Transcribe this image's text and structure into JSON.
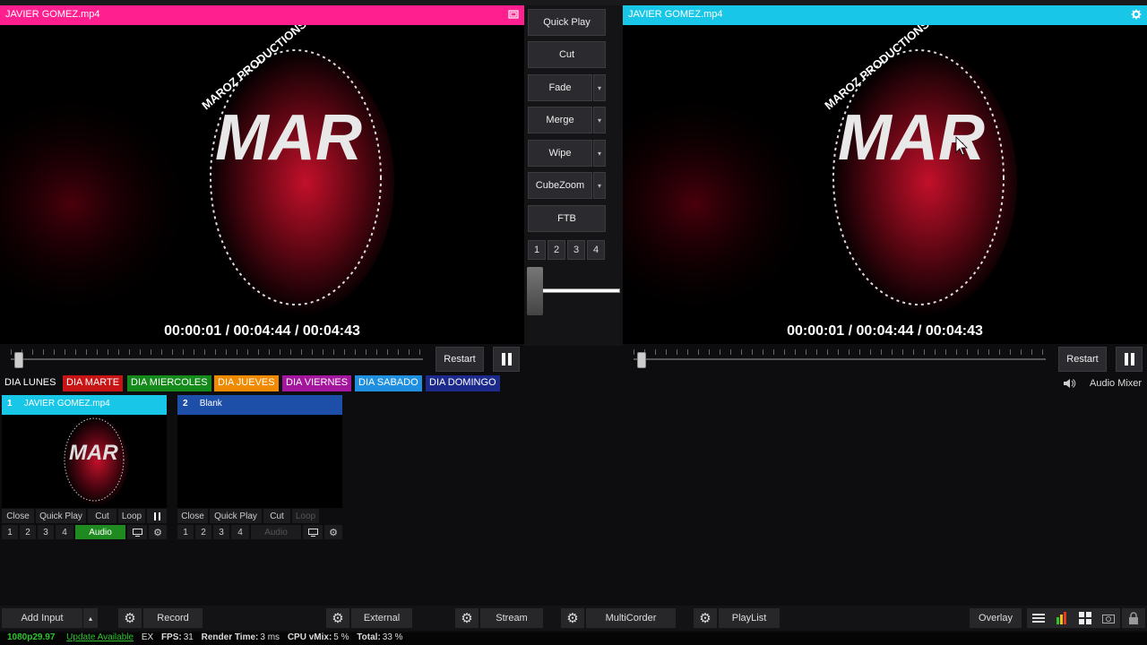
{
  "preview": {
    "title": "JAVIER GOMEZ.mp4",
    "timecode": "00:00:01  /  00:04:44  /  00:04:43",
    "restart_label": "Restart",
    "seek_fraction": 0.02
  },
  "output": {
    "title": "JAVIER GOMEZ.mp4",
    "timecode": "00:00:01  /  00:04:44  /  00:04:43",
    "restart_label": "Restart",
    "seek_fraction": 0.02
  },
  "video_logo": {
    "text": "MAR",
    "ring_text": "MAROZ PRODUCTIONS"
  },
  "transitions": {
    "quick_play": "Quick Play",
    "cut": "Cut",
    "fade": "Fade",
    "merge": "Merge",
    "wipe": "Wipe",
    "cubezoom": "CubeZoom",
    "ftb": "FTB",
    "numbers": [
      "1",
      "2",
      "3",
      "4"
    ]
  },
  "categories": [
    {
      "label": "DIA LUNES",
      "color": ""
    },
    {
      "label": "DIA MARTE",
      "color": "#c81414"
    },
    {
      "label": "DIA MIERCOLES",
      "color": "#138a1a"
    },
    {
      "label": "DIA JUEVES",
      "color": "#f08a00"
    },
    {
      "label": "DIA VIERNES",
      "color": "#a5169e"
    },
    {
      "label": "DIA SABADO",
      "color": "#1f8fe0"
    },
    {
      "label": "DIA DOMINGO",
      "color": "#1c2a8c"
    }
  ],
  "audio_mixer": {
    "label": "Audio Mixer"
  },
  "inputs": [
    {
      "number": "1",
      "name": "JAVIER GOMEZ.mp4",
      "header_color": "#18c7e8",
      "controls": [
        "Close",
        "Quick Play",
        "Cut",
        "Loop"
      ],
      "numbers": [
        "1",
        "2",
        "3",
        "4"
      ],
      "audio_label": "Audio"
    },
    {
      "number": "2",
      "name": "Blank",
      "header_color": "#1d4fa8",
      "controls": [
        "Close",
        "Quick Play",
        "Cut",
        "Loop"
      ],
      "numbers": [
        "1",
        "2",
        "3",
        "4"
      ],
      "audio_label": "Audio"
    }
  ],
  "toolbar": {
    "add_input": "Add Input",
    "record": "Record",
    "external": "External",
    "stream": "Stream",
    "multicorder": "MultiCorder",
    "playlist": "PlayList",
    "overlay": "Overlay"
  },
  "status": {
    "format": "1080p29.97",
    "update": "Update Available",
    "ex": "EX",
    "fps_label": "FPS:",
    "fps_value": "31",
    "render_label": "Render Time:",
    "render_value": "3 ms",
    "cpu_label": "CPU vMix:",
    "cpu_value": "5 %",
    "total_label": "Total:",
    "total_value": "33 %"
  },
  "colors": {
    "preview": "#ff1f8e",
    "output": "#18c7e8",
    "accent": "#2a8cff"
  }
}
